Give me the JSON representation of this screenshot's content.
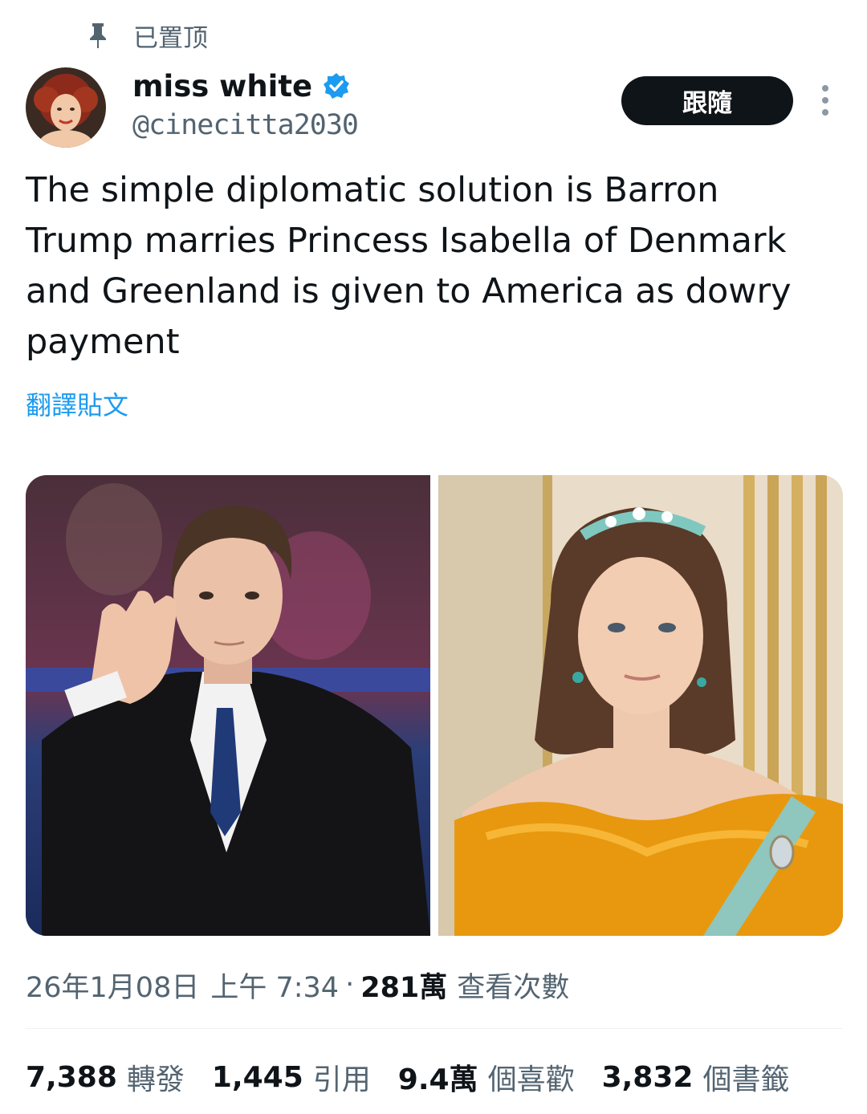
{
  "pinned": {
    "label": "已置顶",
    "icon": "pin-icon"
  },
  "author": {
    "display_name": "miss white",
    "handle": "@cinecitta2030",
    "verified": true,
    "avatar_icon": "avatar"
  },
  "actions": {
    "follow_label": "跟隨",
    "more_icon": "more-vertical-icon"
  },
  "tweet": {
    "text": "The simple diplomatic solution is Barron Trump marries Princess Isabella of Denmark and Greenland is given to America as dowry payment",
    "translate_label": "翻譯貼文"
  },
  "media": [
    {
      "name": "photo-man-in-suit"
    },
    {
      "name": "photo-woman-in-gown"
    }
  ],
  "meta": {
    "date": "26年1月08日",
    "time": "上午 7:34",
    "separator": "·",
    "views_count": "281萬",
    "views_label": "查看次數"
  },
  "stats": {
    "retweets": {
      "count": "7,388",
      "label": "轉發"
    },
    "quotes": {
      "count": "1,445",
      "label": "引用"
    },
    "likes": {
      "count": "9.4萬",
      "label": "個喜歡"
    },
    "bookmarks": {
      "count": "3,832",
      "label": "個書籤"
    }
  },
  "colors": {
    "text": "#0f1419",
    "secondary": "#536471",
    "link": "#1d9bf0",
    "verified": "#1d9bf0",
    "button_bg": "#0f1419"
  }
}
